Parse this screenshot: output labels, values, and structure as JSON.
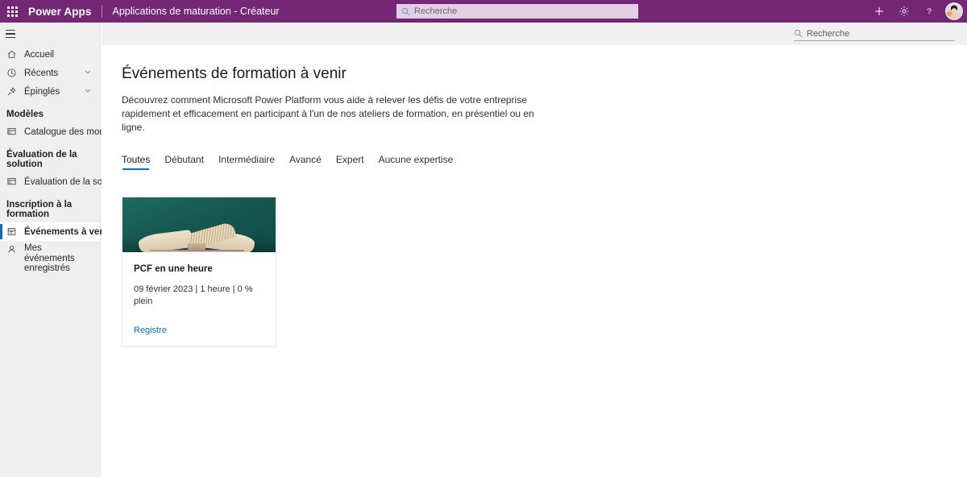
{
  "header": {
    "waffle_icon": "app-launcher-waffle-icon",
    "brand": "Power Apps",
    "environment": "Applications de maturation - Créateur",
    "search": {
      "icon": "search-icon",
      "placeholder": "Recherche",
      "value": ""
    },
    "actions": [
      {
        "name": "new-button",
        "icon": "plus-icon",
        "glyph": "+"
      },
      {
        "name": "settings-button",
        "icon": "gear-icon",
        "glyph": "gear"
      },
      {
        "name": "help-button",
        "icon": "question-mark-icon",
        "glyph": "?"
      }
    ],
    "avatar": "user-avatar",
    "background_color": "#742774",
    "search_background": "#e2cfe2"
  },
  "command_bar": {
    "search": {
      "icon": "search-icon",
      "placeholder": "Recherche",
      "value": ""
    },
    "background_color": "#f0f0f0"
  },
  "sidebar": {
    "hamburger": "hamburger-menu-icon",
    "background_color": "#efefef",
    "selected_indicator_color": "#0f6cbd",
    "items": [
      {
        "label": "Accueil",
        "icon": "home-icon",
        "chevron": false,
        "selected": false
      },
      {
        "label": "Récents",
        "icon": "clock-icon",
        "chevron": true,
        "selected": false
      },
      {
        "label": "Épinglés",
        "icon": "pin-icon",
        "chevron": true,
        "selected": false
      }
    ],
    "groups": [
      {
        "heading": "Modèles",
        "items": [
          {
            "label": "Catalogue des modèles",
            "icon": "template-catalog-icon",
            "selected": false
          }
        ]
      },
      {
        "heading": "Évaluation de la solution",
        "items": [
          {
            "label": "Évaluation de la solution",
            "icon": "solution-checker-icon",
            "selected": false
          }
        ]
      },
      {
        "heading": "Inscription à la formation",
        "items": [
          {
            "label": "Événements à venir",
            "icon": "calendar-event-icon",
            "selected": true
          },
          {
            "label": "Mes événements enregistrés",
            "icon": "person-icon",
            "selected": false
          }
        ]
      }
    ]
  },
  "main": {
    "title": "Événements de formation à venir",
    "description": "Découvrez comment Microsoft Power Platform vous aide à relever les défis de votre entreprise rapidement et efficacement en participant à l'un de nos ateliers de formation, en présentiel ou en ligne.",
    "tabs": [
      {
        "label": "Toutes",
        "active": true
      },
      {
        "label": "Débutant",
        "active": false
      },
      {
        "label": "Intermédiaire",
        "active": false
      },
      {
        "label": "Avancé",
        "active": false
      },
      {
        "label": "Expert",
        "active": false
      },
      {
        "label": "Aucune expertise",
        "active": false
      }
    ],
    "active_tab_color": "#0f6cbd",
    "cards": [
      {
        "image": "open-book-on-teal-background",
        "title": "PCF en une heure",
        "meta": "09 février 2023 | 1 heure | 0 % plein",
        "date": "09 février 2023",
        "duration": "1 heure",
        "capacity": "0 % plein",
        "link_label": "Registre",
        "link_color": "#0f6cbd"
      }
    ]
  }
}
